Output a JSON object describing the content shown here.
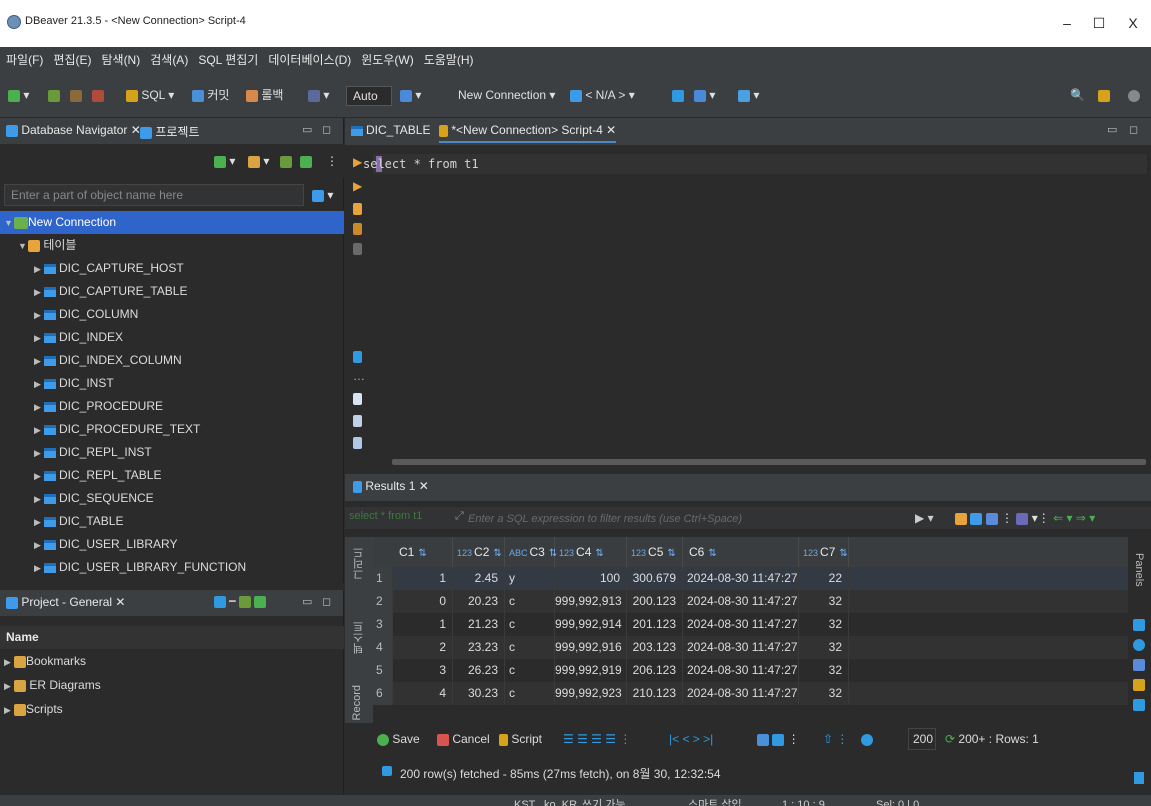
{
  "window": {
    "title": "DBeaver 21.3.5 - <New Connection> Script-4",
    "minimize": "–",
    "maximize": "☐",
    "close": "X"
  },
  "menu": [
    "파일(F)",
    "편집(E)",
    "탐색(N)",
    "검색(A)",
    "SQL 편집기",
    "데이터베이스(D)",
    "윈도우(W)",
    "도움말(H)"
  ],
  "toolbar": {
    "sql": "SQL",
    "commit": "커밋",
    "rollback": "롤백",
    "auto": "Auto",
    "connection": "New Connection",
    "schema": "< N/A >"
  },
  "navigator": {
    "tab_label": "Database Navigator",
    "project_tab": "프로젝트",
    "filter_placeholder": "Enter a part of object name here",
    "connection": "New Connection",
    "tables_folder": "테이블",
    "tables": [
      "DIC_CAPTURE_HOST",
      "DIC_CAPTURE_TABLE",
      "DIC_COLUMN",
      "DIC_INDEX",
      "DIC_INDEX_COLUMN",
      "DIC_INST",
      "DIC_PROCEDURE",
      "DIC_PROCEDURE_TEXT",
      "DIC_REPL_INST",
      "DIC_REPL_TABLE",
      "DIC_SEQUENCE",
      "DIC_TABLE",
      "DIC_USER_LIBRARY",
      "DIC_USER_LIBRARY_FUNCTION"
    ]
  },
  "project": {
    "tab_label": "Project - General",
    "column_header": "Name",
    "items": [
      "Bookmarks",
      "ER Diagrams",
      "Scripts"
    ]
  },
  "editor": {
    "tabs": [
      "DIC_TABLE",
      "*<New Connection> Script-4"
    ],
    "sql": "select * from t1"
  },
  "results": {
    "tab_label": "Results 1",
    "filter_query": "select * from t1",
    "filter_placeholder": "Enter a SQL expression to filter results (use Ctrl+Space)",
    "side_labels": [
      "그리드",
      "텍스트",
      "Record"
    ],
    "panels_label": "Panels",
    "columns": [
      "C1",
      "C2",
      "C3",
      "C4",
      "C5",
      "C6",
      "C7"
    ],
    "column_types": [
      "",
      "123",
      "ABC",
      "123",
      "123",
      "",
      "123"
    ],
    "rows": [
      [
        "1",
        "1",
        "2.45",
        "y",
        "100",
        "300.679",
        "2024-08-30 11:47:27.000",
        "22"
      ],
      [
        "2",
        "0",
        "20.23",
        "c",
        "999,992,913",
        "200.123",
        "2024-08-30 11:47:27.000",
        "32"
      ],
      [
        "3",
        "1",
        "21.23",
        "c",
        "999,992,914",
        "201.123",
        "2024-08-30 11:47:27.000",
        "32"
      ],
      [
        "4",
        "2",
        "23.23",
        "c",
        "999,992,916",
        "203.123",
        "2024-08-30 11:47:27.000",
        "32"
      ],
      [
        "5",
        "3",
        "26.23",
        "c",
        "999,992,919",
        "206.123",
        "2024-08-30 11:47:27.000",
        "32"
      ],
      [
        "6",
        "4",
        "30.23",
        "c",
        "999,992,923",
        "210.123",
        "2024-08-30 11:47:27.000",
        "32"
      ]
    ],
    "save": "Save",
    "cancel": "Cancel",
    "script": "Script",
    "limit": "200",
    "rows_label": "200+ : Rows: 1",
    "status_message": "200 row(s) fetched - 85ms (27ms fetch), on 8월 30, 12:32:54"
  },
  "statusbar": {
    "timezone": "KST",
    "locale": "ko_KR",
    "mode": "쓰기 가능",
    "insert": "스마트 삽입",
    "position": "1 : 10 : 9",
    "selection": "Sel: 0 | 0"
  }
}
